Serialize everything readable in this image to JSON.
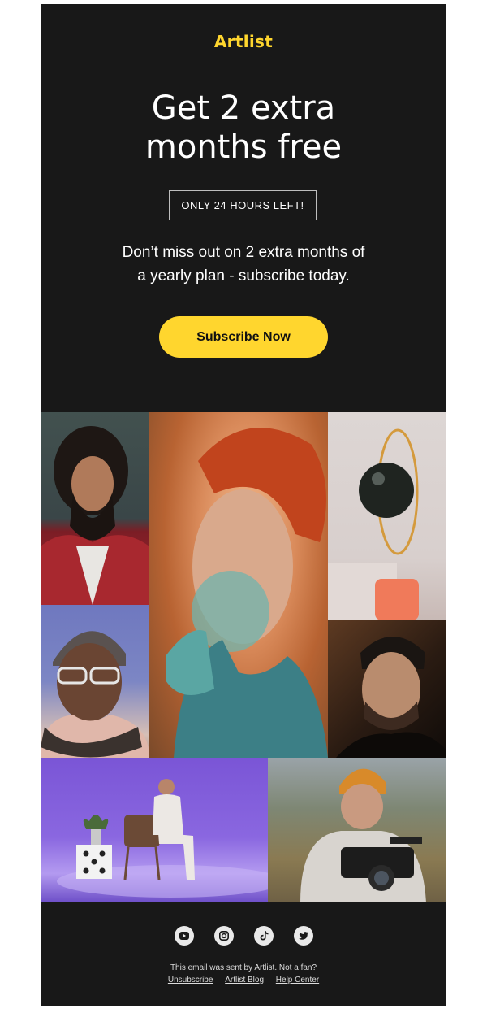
{
  "header": {
    "logo_text": "Artlist"
  },
  "hero": {
    "headline_line1": "Get 2 extra",
    "headline_line2": "months free",
    "badge": "ONLY 24 HOURS LEFT!",
    "body_line1": "Don’t miss out on 2 extra months of",
    "body_line2": "a yearly plan - subscribe today.",
    "cta_label": "Subscribe Now"
  },
  "colors": {
    "background": "#181818",
    "accent": "#ffd62e",
    "page": "#ffffff"
  },
  "gallery": {
    "images": [
      "portrait-bearded-man-red-jacket",
      "portrait-red-haired-woman",
      "black-sphere-sculpture",
      "portrait-man-beanie-glasses",
      "portrait-man-dark-background",
      "man-seated-purple-studio",
      "cameraman-orange-beanie-field"
    ]
  },
  "footer": {
    "social_icons": [
      "youtube-icon",
      "instagram-icon",
      "tiktok-icon",
      "twitter-icon"
    ],
    "sent_by_text": "This email was sent by Artlist. Not a fan?",
    "links": {
      "unsubscribe": "Unsubscribe",
      "blog": "Artlist Blog",
      "help": "Help Center"
    }
  }
}
